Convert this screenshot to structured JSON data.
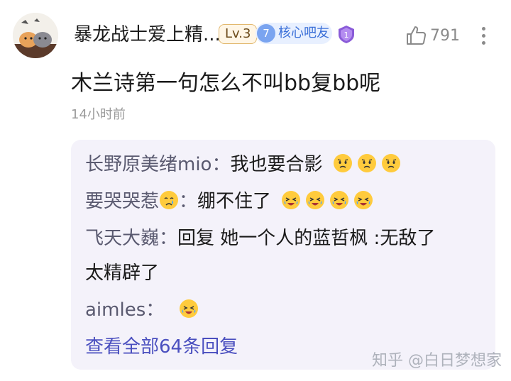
{
  "header": {
    "username": "暴龙战士爱上精...",
    "level_badge": "Lv.3",
    "core_badge_number": "7",
    "core_badge_label": "核心吧友",
    "like_count": "791"
  },
  "post": {
    "content": "木兰诗第一句怎么不叫bb复bb呢",
    "timestamp": "14小时前"
  },
  "replies": [
    {
      "author": "长野原美绪mio",
      "separator": "：",
      "text": "我也要合影",
      "emoji_count": 3
    },
    {
      "author": "要哭哭惹",
      "separator": "：",
      "text": "绷不住了",
      "emoji_count": 4
    },
    {
      "author": "飞天大巍",
      "separator": "：",
      "text": "回复 她一个人的蓝哲枫 :无敌了",
      "text_line2": "太精辟了"
    },
    {
      "author": "aimles",
      "separator": "：",
      "text": "",
      "emoji_count": 1
    }
  ],
  "view_all_label": "查看全部64条回复",
  "watermark": "知乎 @白日梦想家",
  "colors": {
    "reply_bg": "#f4f2fa",
    "view_all": "#4a4fbf",
    "core_badge": "#3a6fd8",
    "emoji": "#ffcb3d"
  }
}
